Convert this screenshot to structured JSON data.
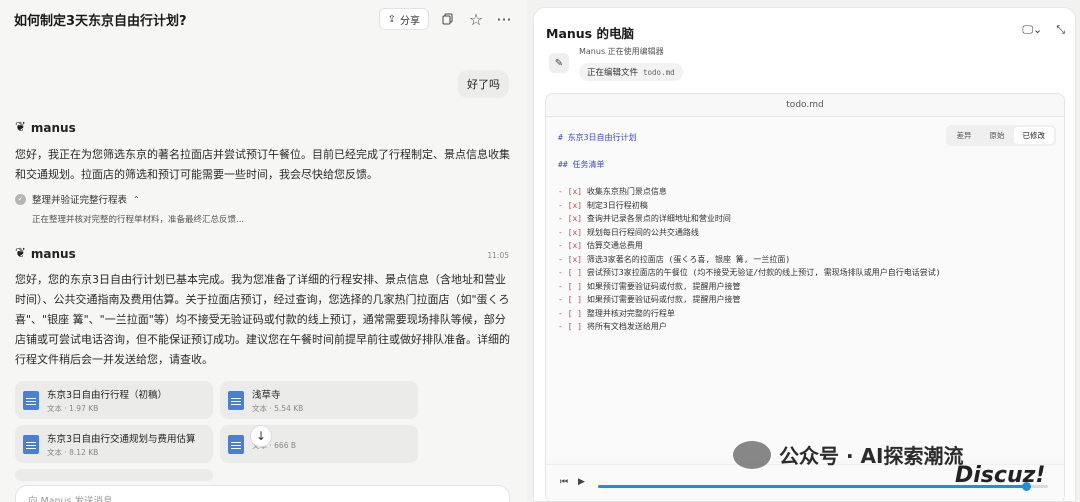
{
  "header": {
    "title": "如何制定3天东京自由行计划?",
    "share_label": "分享"
  },
  "conversation": {
    "user_message": "好了吗",
    "assistant_name": "manus",
    "message1": "您好，我正在为您筛选东京的著名拉面店并尝试预订午餐位。目前已经完成了行程制定、景点信息收集和交通规划。拉面店的筛选和预订可能需要一些时间，我会尽快给您反馈。",
    "task_title": "整理并验证完整行程表",
    "task_detail": "正在整理并核对完整的行程单材料，准备最终汇总反馈...",
    "time2": "11:05",
    "message2": "您好，您的东京3日自由行计划已基本完成。我为您准备了详细的行程安排、景点信息（含地址和营业时间）、公共交通指南及费用估算。关于拉面店预订，经过查询，您选择的几家热门拉面店（如\"蛋くろ喜\"、\"银座 篝\"、\"一兰拉面\"等）均不接受无验证码或付款的线上预订，通常需要现场排队等候，部分店铺或可尝试电话咨询，但不能保证预订成功。建议您在午餐时间前提早前往或做好排队准备。详细的行程文件稍后会一并发送给您，请查收。"
  },
  "files": [
    {
      "name": "东京3日自由行行程（初稿）",
      "meta": "文本 · 1.97 KB"
    },
    {
      "name": "浅草寺",
      "meta": "文本 · 5.54 KB"
    },
    {
      "name": "东京3日自由行交通规划与费用估算",
      "meta": "文本 · 8.12 KB"
    },
    {
      "name": "",
      "meta": "文本 · 666 B"
    }
  ],
  "input": {
    "placeholder": "向 Manus 发送消息"
  },
  "computer": {
    "title": "Manus 的电脑",
    "using": "Manus 正在使用编辑器",
    "editing_label": "正在编辑文件",
    "editing_file": "todo.md",
    "doc_title": "todo.md",
    "views": [
      "差异",
      "原始",
      "已修改"
    ],
    "active_view": "已修改"
  },
  "markdown": [
    {
      "prefix": "# ",
      "text": "东京3日自由行计划",
      "kind": "h1"
    },
    {
      "prefix": "",
      "text": "",
      "kind": "blank"
    },
    {
      "prefix": "## ",
      "text": "任务清单",
      "kind": "h2"
    },
    {
      "prefix": "",
      "text": "",
      "kind": "blank"
    },
    {
      "prefix": "- [x] ",
      "text": "收集东京热门景点信息",
      "kind": "item"
    },
    {
      "prefix": "- [x] ",
      "text": "制定3日行程初稿",
      "kind": "item"
    },
    {
      "prefix": "- [x] ",
      "text": "查询并记录各景点的详细地址和营业时间",
      "kind": "item"
    },
    {
      "prefix": "- [x] ",
      "text": "规划每日行程间的公共交通路线",
      "kind": "item"
    },
    {
      "prefix": "- [x] ",
      "text": "估算交通总费用",
      "kind": "item"
    },
    {
      "prefix": "- [x] ",
      "text": "筛选3家著名的拉面店 (蛋くろ喜, 银座 篝, 一兰拉面)",
      "kind": "item"
    },
    {
      "prefix": "- [ ] ",
      "text": "尝试预订3家拉面店的午餐位 (均不接受无验证/付款的线上预订, 需现场排队或用户自行电话尝试)",
      "kind": "item"
    },
    {
      "prefix": "- [ ] ",
      "text": "如果预订需要验证码或付款, 提醒用户接管",
      "kind": "item"
    },
    {
      "prefix": "- [ ] ",
      "text": "如果预订需要验证码或付款, 提醒用户接管",
      "kind": "item"
    },
    {
      "prefix": "- [ ] ",
      "text": "整理并核对完整的行程单",
      "kind": "item"
    },
    {
      "prefix": "- [ ] ",
      "text": "将所有文档发送给用户",
      "kind": "item"
    }
  ],
  "playback": {
    "progress": 0.95
  },
  "watermark": {
    "text": "公众号 · AI探索潮流",
    "site": "Discuz!"
  }
}
